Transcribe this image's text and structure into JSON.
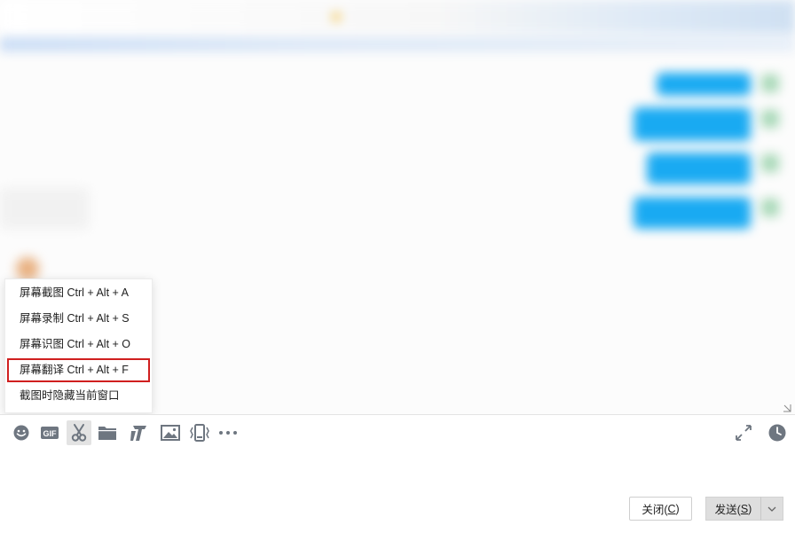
{
  "window": {
    "title": "",
    "header_strip_text": ""
  },
  "screenshot_menu": {
    "items": [
      {
        "label": "屏幕截图 Ctrl + Alt + A",
        "highlighted": false
      },
      {
        "label": "屏幕录制 Ctrl + Alt + S",
        "highlighted": false
      },
      {
        "label": "屏幕识图 Ctrl + Alt + O",
        "highlighted": false
      },
      {
        "label": "屏幕翻译 Ctrl + Alt + F",
        "highlighted": true
      },
      {
        "label": "截图时隐藏当前窗口",
        "highlighted": false
      }
    ],
    "highlight_color": "#d01f1f"
  },
  "toolbar": {
    "icons": [
      "emoji-icon",
      "gif-icon",
      "scissors-icon",
      "folder-icon",
      "music-icon",
      "image-icon",
      "shake-icon",
      "more-icon"
    ],
    "active_icon": "scissors-icon",
    "right_icons": [
      "expand-icon",
      "history-clock-icon"
    ]
  },
  "buttons": {
    "close_label": "关闭(",
    "close_key": "C",
    "close_suffix": ")",
    "send_label": "发送(",
    "send_key": "S",
    "send_suffix": ")"
  },
  "colors": {
    "bubble": "#19aaf2",
    "icon": "#6e7680"
  }
}
